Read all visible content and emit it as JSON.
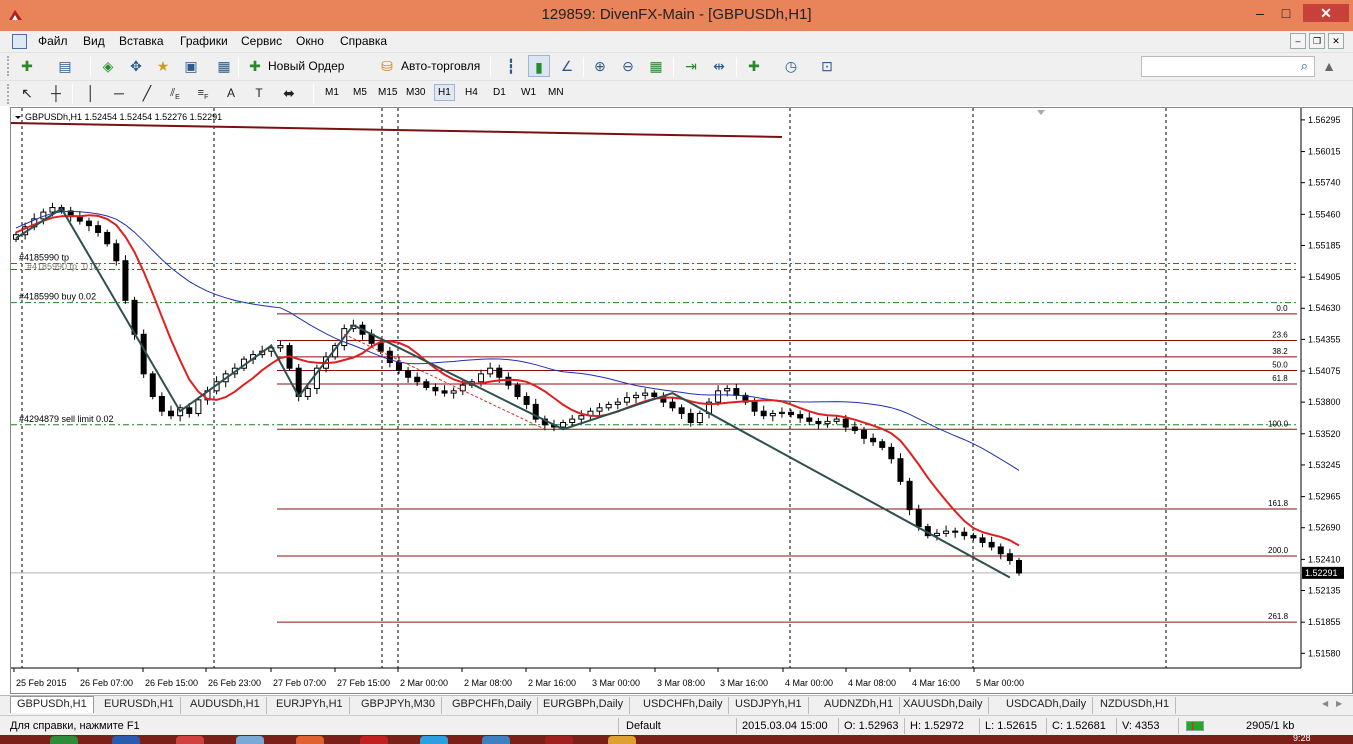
{
  "window": {
    "title": "129859: DivenFX-Main - [GBPUSDh,H1]",
    "minimize": "–",
    "maximize": "□",
    "close": "✕"
  },
  "menu": [
    "Файл",
    "Вид",
    "Вставка",
    "Графики",
    "Сервис",
    "Окно",
    "Справка"
  ],
  "toolbar": {
    "new_order": "Новый Ордер",
    "autotrading": "Авто-торговля",
    "search_placeholder": ""
  },
  "timeframes": [
    "M1",
    "M5",
    "M15",
    "M30",
    "H1",
    "H4",
    "D1",
    "W1",
    "MN"
  ],
  "active_timeframe": "H1",
  "tools": {
    "fib_e": "E",
    "fib_f": "F",
    "text_tool": "A",
    "label_tool": "T"
  },
  "chart": {
    "header": "GBPUSDh,H1  1.52454 1.52454 1.52276 1.52291",
    "current_price": "1.52291",
    "price_ticks": [
      "1.56295",
      "1.56015",
      "1.55740",
      "1.55460",
      "1.55185",
      "1.54905",
      "1.54630",
      "1.54355",
      "1.54075",
      "1.53800",
      "1.53520",
      "1.53245",
      "1.52965",
      "1.52690",
      "1.52410",
      "1.52135",
      "1.51855",
      "1.51580"
    ],
    "time_ticks": [
      "25 Feb 2015",
      "26 Feb 07:00",
      "26 Feb 15:00",
      "26 Feb 23:00",
      "27 Feb 07:00",
      "27 Feb 15:00",
      "2 Mar 00:00",
      "2 Mar 08:00",
      "2 Mar 16:00",
      "3 Mar 00:00",
      "3 Mar 08:00",
      "3 Mar 16:00",
      "4 Mar 00:00",
      "4 Mar 08:00",
      "4 Mar 16:00",
      "5 Mar 00:00"
    ],
    "order_labels": [
      {
        "text": "#4185990 tp",
        "price": 1.5499
      },
      {
        "text": "#4185990 buy 0.02",
        "price": 1.5468
      },
      {
        "text": "#4294879 sell limit 0.02",
        "price": 1.536
      }
    ],
    "order_overlap": "#4185990 tp",
    "order_overlap_2": "0.02",
    "fib_levels": [
      {
        "label": "0.0",
        "price": 1.5458
      },
      {
        "label": "23.6",
        "price": 1.54345
      },
      {
        "label": "38.2",
        "price": 1.542
      },
      {
        "label": "50.0",
        "price": 1.5408
      },
      {
        "label": "61.8",
        "price": 1.5396
      },
      {
        "label": "100.0",
        "price": 1.5356
      },
      {
        "label": "161.8",
        "price": 1.52855
      },
      {
        "label": "200.0",
        "price": 1.5244
      },
      {
        "label": "261.8",
        "price": 1.51855
      }
    ]
  },
  "chart_data": {
    "type": "line",
    "title": "GBPUSDh,H1",
    "ylim": [
      1.5145,
      1.564
    ],
    "series": [],
    "y_ticks": [
      1.56295,
      1.56015,
      1.5574,
      1.5546,
      1.55185,
      1.54905,
      1.5463,
      1.54355,
      1.54075,
      1.538,
      1.5352,
      1.53245,
      1.52965,
      1.5269,
      1.5241,
      1.52135,
      1.51855,
      1.5158
    ],
    "close_approx": [
      1.5528,
      1.5535,
      1.5542,
      1.5548,
      1.5552,
      1.5549,
      1.5544,
      1.554,
      1.5536,
      1.553,
      1.552,
      1.5505,
      1.547,
      1.544,
      1.5405,
      1.5385,
      1.5372,
      1.5368,
      1.5375,
      1.537,
      1.5382,
      1.539,
      1.5398,
      1.5405,
      1.541,
      1.5418,
      1.5422,
      1.5425,
      1.5428,
      1.543,
      1.541,
      1.5385,
      1.5392,
      1.541,
      1.542,
      1.543,
      1.5445,
      1.5448,
      1.544,
      1.5432,
      1.5425,
      1.5415,
      1.5408,
      1.5402,
      1.5398,
      1.5393,
      1.539,
      1.5388,
      1.539,
      1.5395,
      1.5398,
      1.5405,
      1.541,
      1.5402,
      1.5395,
      1.5385,
      1.5378,
      1.5365,
      1.536,
      1.5358,
      1.5362,
      1.5365,
      1.5368,
      1.5372,
      1.5375,
      1.5378,
      1.538,
      1.5384,
      1.5386,
      1.5388,
      1.5385,
      1.538,
      1.5375,
      1.537,
      1.5362,
      1.537,
      1.538,
      1.539,
      1.5392,
      1.5386,
      1.538,
      1.5372,
      1.5368,
      1.537,
      1.5371,
      1.5369,
      1.5366,
      1.5363,
      1.5361,
      1.5363,
      1.5365,
      1.5358,
      1.5355,
      1.5348,
      1.5345,
      1.534,
      1.533,
      1.531,
      1.5285,
      1.527,
      1.5262,
      1.5264,
      1.5266,
      1.5265,
      1.5262,
      1.526,
      1.5256,
      1.5252,
      1.5246,
      1.524,
      1.5229
    ]
  },
  "symbol_tabs": [
    "GBPUSDh,H1",
    "EURUSDh,H1",
    "AUDUSDh,H1",
    "EURJPYh,H1",
    "GBPJPYh,M30",
    "GBPCHFh,Daily",
    "EURGBPh,Daily",
    "USDCHFh,Daily",
    "USDJPYh,H1",
    "AUDNZDh,H1",
    "XAUUSDh,Daily",
    "USDCADh,Daily",
    "NZDUSDh,H1"
  ],
  "status": {
    "help": "Для справки, нажмите F1",
    "profile": "Default",
    "datetime": "2015.03.04 15:00",
    "open": "O: 1.52963",
    "high": "H: 1.52972",
    "low": "L: 1.52615",
    "close": "C: 1.52681",
    "volume": "V: 4353",
    "traffic": "2905/1 kb"
  },
  "taskbar": {
    "clock": "9:28"
  }
}
